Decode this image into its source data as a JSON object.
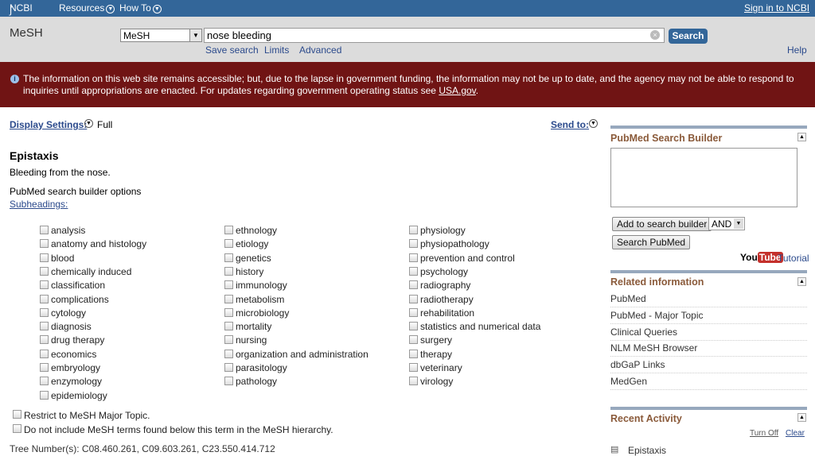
{
  "topbar": {
    "logo": "NCBI",
    "resources": "Resources",
    "howto": "How To",
    "signin": "Sign in to NCBI"
  },
  "search": {
    "db_label": "MeSH",
    "db_select": "MeSH",
    "query": "nose bleeding",
    "button": "Search",
    "links": [
      "Save search",
      "Limits",
      "Advanced"
    ],
    "help": "Help"
  },
  "banner": {
    "text": "The information on this web site remains accessible; but, due to the lapse in government funding, the information may not be up to date, and the agency may not be able to respond to inquiries until appropriations are enacted. For updates regarding government operating status see ",
    "link": "USA.gov",
    "end": "."
  },
  "display": {
    "label": "Display Settings:",
    "value": "Full",
    "send_to": "Send to:"
  },
  "term": {
    "title": "Epistaxis",
    "definition": "Bleeding from the nose.",
    "builder_options": "PubMed search builder options",
    "subheadings": "Subheadings:"
  },
  "subheadings": [
    [
      "analysis",
      "anatomy and histology",
      "blood",
      "chemically induced",
      "classification",
      "complications",
      "cytology",
      "diagnosis",
      "drug therapy",
      "economics",
      "embryology",
      "enzymology",
      "epidemiology"
    ],
    [
      "ethnology",
      "etiology",
      "genetics",
      "history",
      "immunology",
      "metabolism",
      "microbiology",
      "mortality",
      "nursing",
      "organization and administration",
      "parasitology",
      "pathology"
    ],
    [
      "physiology",
      "physiopathology",
      "prevention and control",
      "psychology",
      "radiography",
      "radiotherapy",
      "rehabilitation",
      "statistics and numerical data",
      "surgery",
      "therapy",
      "veterinary",
      "virology"
    ]
  ],
  "options": [
    "Restrict to MeSH Major Topic.",
    "Do not include MeSH terms found below this term in the MeSH hierarchy."
  ],
  "tree_numbers": "Tree Number(s): C08.460.261, C09.603.261, C23.550.414.712",
  "sidebar": {
    "builder_title": "PubMed Search Builder",
    "add_button": "Add to search builder",
    "operator": "AND",
    "search_button": "Search PubMed",
    "youtube_you": "You",
    "youtube_tube": "Tube",
    "tutorial": "Tutorial",
    "related_title": "Related information",
    "related": [
      "PubMed",
      "PubMed - Major Topic",
      "Clinical Queries",
      "NLM MeSH Browser",
      "dbGaP Links",
      "MedGen"
    ],
    "recent_title": "Recent Activity",
    "turn_off": "Turn Off",
    "clear": "Clear",
    "recent": [
      "Epistaxis"
    ]
  },
  "colors": {
    "topbar": "#336699",
    "banner": "#701414",
    "section_title": "#8a5a3a"
  }
}
